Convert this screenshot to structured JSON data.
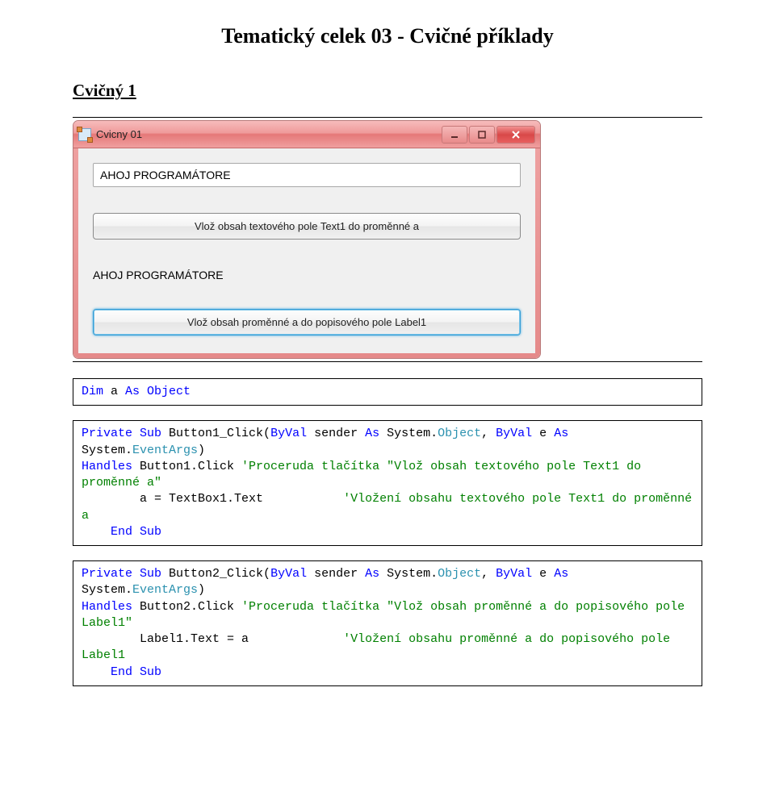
{
  "heading": "Tematický celek 03 - Cvičné příklady",
  "subheading": "Cvičný 1",
  "window": {
    "title": "Cvicny 01",
    "textbox_value": "AHOJ PROGRAMÁTORE",
    "button1_label": "Vlož obsah textového pole Text1 do proměnné a",
    "label_output": "AHOJ PROGRAMÁTORE",
    "button2_label": "Vlož obsah proměnné a do popisového pole Label1"
  },
  "code1": {
    "l1_dim": "Dim",
    "l1_rest": " a ",
    "l1_as": "As",
    "l1_obj": " Object"
  },
  "code2": {
    "l1_a": "Private",
    "l1_b": " Sub",
    "l1_c": " Button1_Click(",
    "l1_d": "ByVal",
    "l1_e": " sender ",
    "l1_f": "As",
    "l1_g": " System.",
    "l1_h": "Object",
    "l1_i": ", ",
    "l1_j": "ByVal",
    "l1_k": " e ",
    "l1_l": "As",
    "l1_m": " System.",
    "l1_n": "EventArgs",
    "l1_o": ") ",
    "l2_a": "Handles",
    "l2_b": " Button1.Click ",
    "l2_c": "'Proceruda tlačítka \"Vlož obsah textového pole Text1 do proměnné a\"",
    "l3_a": "        a = TextBox1.Text           ",
    "l3_b": "'Vložení obsahu textového pole Text1 do proměnné a",
    "l4_a": "    End",
    "l4_b": " Sub"
  },
  "code3": {
    "l1_a": "Private",
    "l1_b": " Sub",
    "l1_c": " Button2_Click(",
    "l1_d": "ByVal",
    "l1_e": " sender ",
    "l1_f": "As",
    "l1_g": " System.",
    "l1_h": "Object",
    "l1_i": ", ",
    "l1_j": "ByVal",
    "l1_k": " e ",
    "l1_l": "As",
    "l1_m": " System.",
    "l1_n": "EventArgs",
    "l1_o": ") ",
    "l2_a": "Handles",
    "l2_b": " Button2.Click ",
    "l2_c": "'Proceruda tlačítka \"Vlož obsah proměnné a do popisového pole Label1\"",
    "l3_a": "        Label1.Text = a             ",
    "l3_b": "'Vložení obsahu proměnné a do popisového pole Label1",
    "l4_a": "    End",
    "l4_b": " Sub"
  }
}
